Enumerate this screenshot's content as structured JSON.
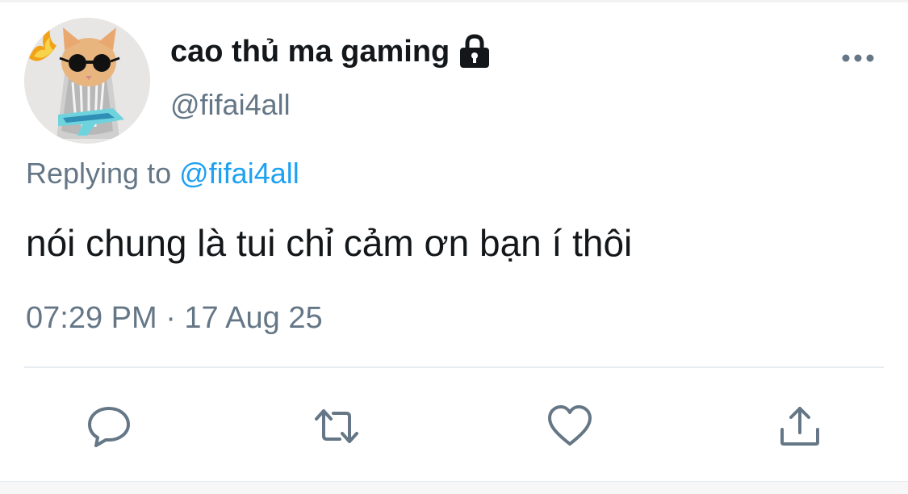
{
  "user": {
    "display_name": "cao thủ ma gaming",
    "handle": "@fifai4all",
    "avatar_icon": "cat-with-sunglasses-avatar",
    "protected_icon": "lock-icon"
  },
  "reply_context": {
    "prefix": "Replying to",
    "mention": "@fifai4all"
  },
  "tweet": {
    "text": "nói chung là tui chỉ cảm ơn bạn í thôi",
    "timestamp": "07:29 PM · 17 Aug 25"
  },
  "actions": [
    {
      "name": "reply",
      "icon": "comment-icon"
    },
    {
      "name": "retweet",
      "icon": "retweet-icon"
    },
    {
      "name": "like",
      "icon": "heart-icon"
    },
    {
      "name": "share",
      "icon": "share-icon"
    }
  ],
  "colors": {
    "text_primary": "#14171a",
    "text_secondary": "#657786",
    "accent": "#1da1f2",
    "divider": "#e6ecf0"
  }
}
